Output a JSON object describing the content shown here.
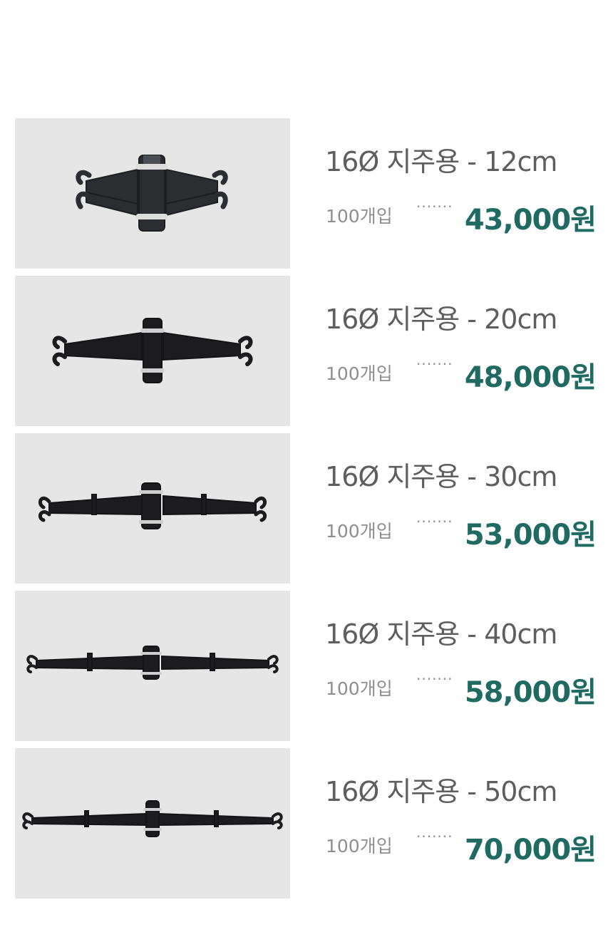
{
  "accent_color": "#1f6b62",
  "products": [
    {
      "title": "16Ø 지주용 - 12cm",
      "qty": "100개입",
      "dots": "·······",
      "price": "43,000원",
      "image_icon": "clamp-12cm-icon"
    },
    {
      "title": "16Ø 지주용 - 20cm",
      "qty": "100개입",
      "dots": "·······",
      "price": "48,000원",
      "image_icon": "clamp-20cm-icon"
    },
    {
      "title": "16Ø 지주용 - 30cm",
      "qty": "100개입",
      "dots": "·······",
      "price": "53,000원",
      "image_icon": "clamp-30cm-icon"
    },
    {
      "title": "16Ø 지주용 - 40cm",
      "qty": "100개입",
      "dots": "·······",
      "price": "58,000원",
      "image_icon": "clamp-40cm-icon"
    },
    {
      "title": "16Ø 지주용 - 50cm",
      "qty": "100개입",
      "dots": "·······",
      "price": "70,000원",
      "image_icon": "clamp-50cm-icon"
    }
  ]
}
